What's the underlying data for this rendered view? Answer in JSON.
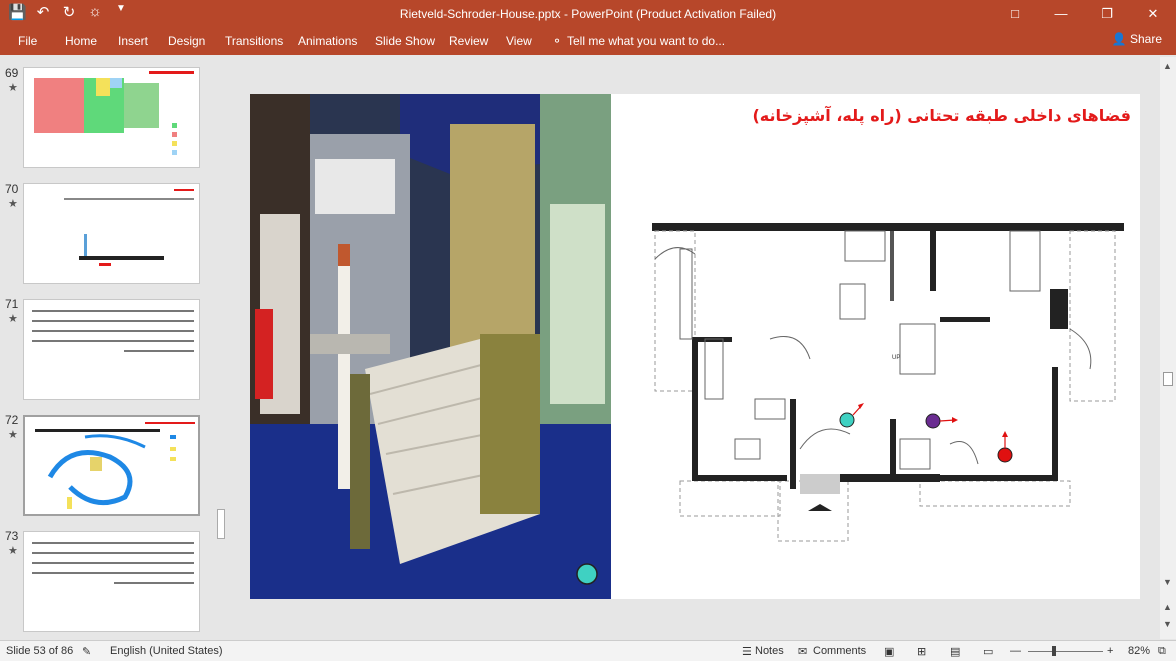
{
  "window": {
    "title": "Rietveld-Schroder-House.pptx - PowerPoint (Product Activation Failed)"
  },
  "ribbon": {
    "tabs": [
      "File",
      "Home",
      "Insert",
      "Design",
      "Transitions",
      "Animations",
      "Slide Show",
      "Review",
      "View"
    ],
    "tell_me": "Tell me what you want to do...",
    "share": "Share"
  },
  "thumbnails": [
    {
      "number": "69",
      "star": "★"
    },
    {
      "number": "70",
      "star": "★"
    },
    {
      "number": "71",
      "star": "★"
    },
    {
      "number": "72",
      "star": "★"
    },
    {
      "number": "73",
      "star": "★"
    }
  ],
  "slide": {
    "title": "فضاهای داخلی طبقه تحتانی (راه پله، آشپزخانه)",
    "floorplan_label": "UP"
  },
  "status": {
    "slide_count": "Slide 53 of 86",
    "language": "English (United States)",
    "notes": "Notes",
    "comments": "Comments",
    "zoom": "82%"
  },
  "colors": {
    "accent": "#b7472a",
    "title_red": "#e31a1a",
    "marker_cyan": "#3fd1c2",
    "marker_purple": "#6a2c91",
    "marker_red": "#e01010"
  }
}
